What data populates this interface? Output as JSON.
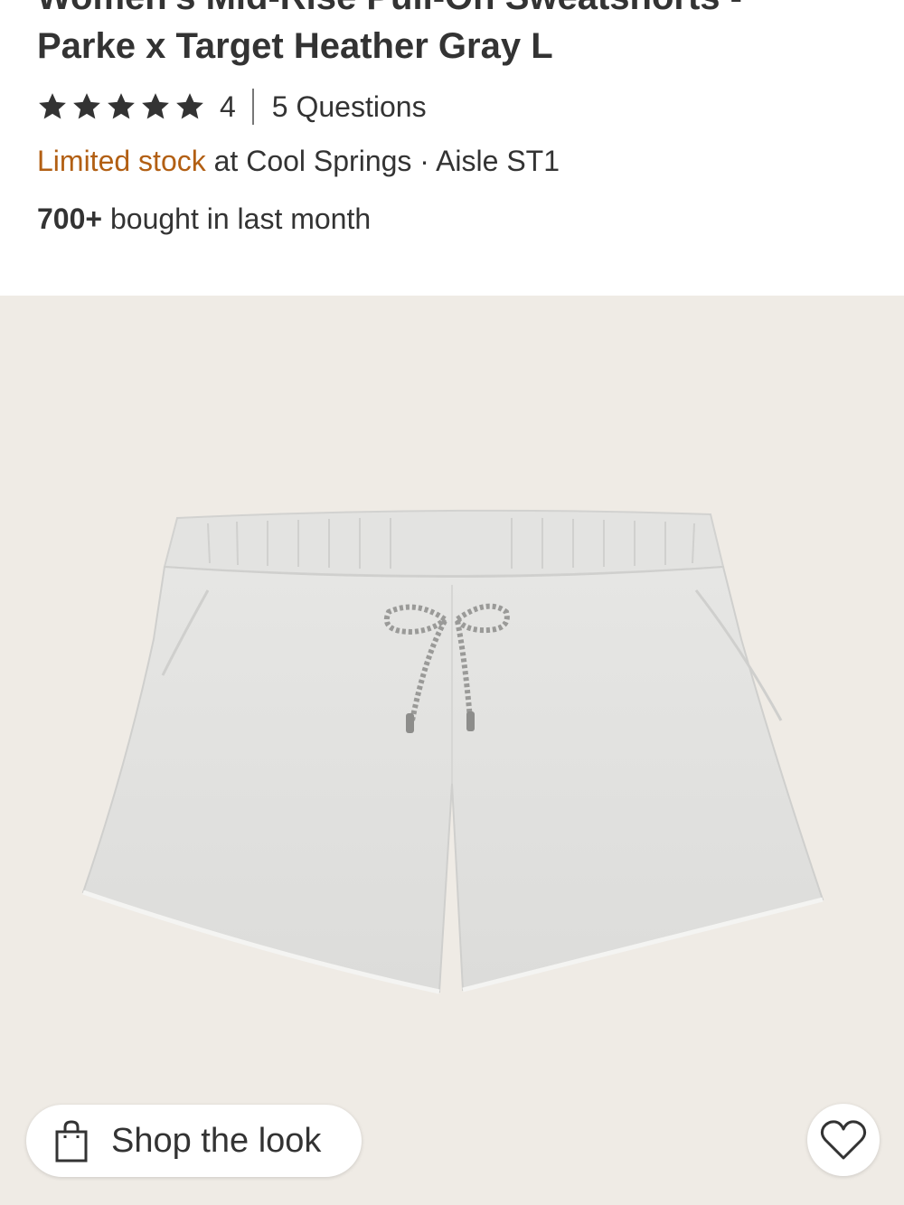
{
  "product": {
    "title_line1": "Women's Mid-Rise Pull-On Sweatshorts -",
    "title_line2": "Parke x Target Heather Gray L",
    "rating": {
      "stars": 5,
      "count": "4",
      "questions": "5 Questions"
    },
    "stock": {
      "status": "Limited stock",
      "location": " at Cool Springs · Aisle ST1"
    },
    "bought": {
      "count": "700+",
      "text": " bought in last month"
    }
  },
  "image": {
    "background": "#efebe5",
    "icon": "product-photo-sweatshorts"
  },
  "actions": {
    "shop_the_look": "Shop the look",
    "shop_icon": "shopping-bag-icon",
    "favorite_icon": "heart-icon"
  },
  "colors": {
    "text": "#333333",
    "stock_accent": "#b25f13"
  }
}
